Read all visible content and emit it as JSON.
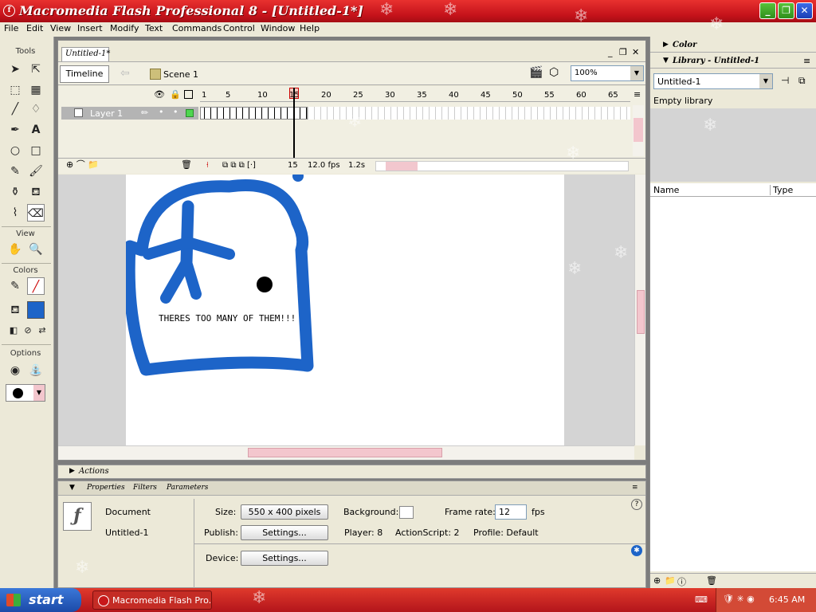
{
  "window": {
    "title": "Macromedia Flash Professional 8 - [Untitled-1*]"
  },
  "menu": [
    "File",
    "Edit",
    "View",
    "Insert",
    "Modify",
    "Text",
    "Commands",
    "Control",
    "Window",
    "Help"
  ],
  "tools": {
    "header": "Tools",
    "view_header": "View",
    "colors_header": "Colors",
    "options_header": "Options"
  },
  "document": {
    "tab": "Untitled-1*",
    "timeline_button": "Timeline",
    "scene": "Scene 1",
    "zoom": "100%"
  },
  "timeline": {
    "layer": "Layer 1",
    "frame_numbers": [
      "1",
      "5",
      "10",
      "15",
      "20",
      "25",
      "30",
      "35",
      "40",
      "45",
      "50",
      "55",
      "60",
      "65"
    ],
    "current_frame": "15",
    "fps": "12.0 fps",
    "time": "1.2s"
  },
  "stage": {
    "text": "THERES TOO MANY OF THEM!!!"
  },
  "actions": {
    "label": "Actions"
  },
  "properties": {
    "tabs": [
      "Properties",
      "Filters",
      "Parameters"
    ],
    "doc_label": "Document",
    "doc_name": "Untitled-1",
    "size_label": "Size:",
    "size_value": "550 x 400 pixels",
    "background_label": "Background:",
    "frame_rate_label": "Frame rate:",
    "frame_rate_value": "12",
    "fps_unit": "fps",
    "publish_label": "Publish:",
    "publish_button": "Settings...",
    "player": "Player: 8",
    "actionscript": "ActionScript: 2",
    "profile": "Profile: Default",
    "device_label": "Device:",
    "device_button": "Settings..."
  },
  "right_panel": {
    "color_header": "Color",
    "library_header": "Library - Untitled-1",
    "library_select": "Untitled-1",
    "empty_library": "Empty library",
    "col_name": "Name",
    "col_type": "Type"
  },
  "taskbar": {
    "start": "start",
    "task": "Macromedia Flash Pro...",
    "time": "6:45 AM"
  },
  "colors": {
    "titlebar": "#c4121a",
    "taskbar": "#b3151b",
    "drawing": "#1d64c8"
  }
}
